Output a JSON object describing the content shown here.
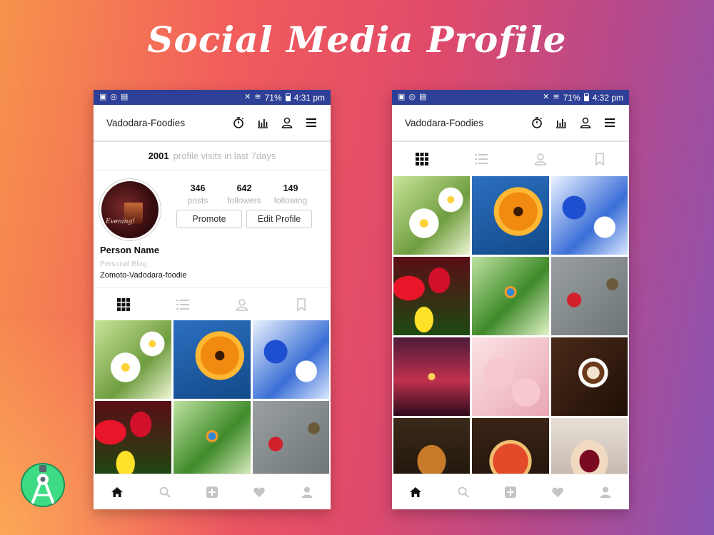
{
  "headline": "Social Media Profile",
  "status_bar": {
    "left": {
      "battery": "71%",
      "time": "4:31 pm"
    },
    "right": {
      "battery": "71%",
      "time": "4:32 pm"
    }
  },
  "app_bar": {
    "title": "Vadodara-Foodies",
    "icons": [
      "timer-icon",
      "bar-chart-icon",
      "person-icon",
      "menu-icon"
    ]
  },
  "visits": {
    "count": "2001",
    "label": "profile visits in last 7days"
  },
  "profile": {
    "avatar_text": "Evening!",
    "stats": [
      {
        "value": "346",
        "label": "posts"
      },
      {
        "value": "642",
        "label": "followers"
      },
      {
        "value": "149",
        "label": "following"
      }
    ],
    "promote_label": "Promote",
    "edit_label": "Edit Profile",
    "name": "Person Name",
    "category": "Personal Blog",
    "link": "Zomoto-Vadodara-foodie"
  },
  "tabs": [
    "grid-icon",
    "list-icon",
    "tagged-person-icon",
    "bookmark-icon"
  ],
  "bottom_nav": [
    "home-icon",
    "search-icon",
    "add-post-icon",
    "heart-icon",
    "profile-icon"
  ],
  "colors": {
    "status_bar": "#2d3f96",
    "accent_active": "#111111",
    "muted": "#b5b5b5"
  },
  "photos_left": [
    "daisy",
    "gerbera",
    "blue-flower",
    "tulips",
    "kingfisher",
    "hummingbird"
  ],
  "photos_right": [
    "daisy",
    "gerbera",
    "blue-flower",
    "tulips",
    "kingfisher",
    "hummingbird",
    "sunset-birds",
    "heart-cookies",
    "coffee",
    "grilled-food",
    "pizza",
    "cake"
  ]
}
